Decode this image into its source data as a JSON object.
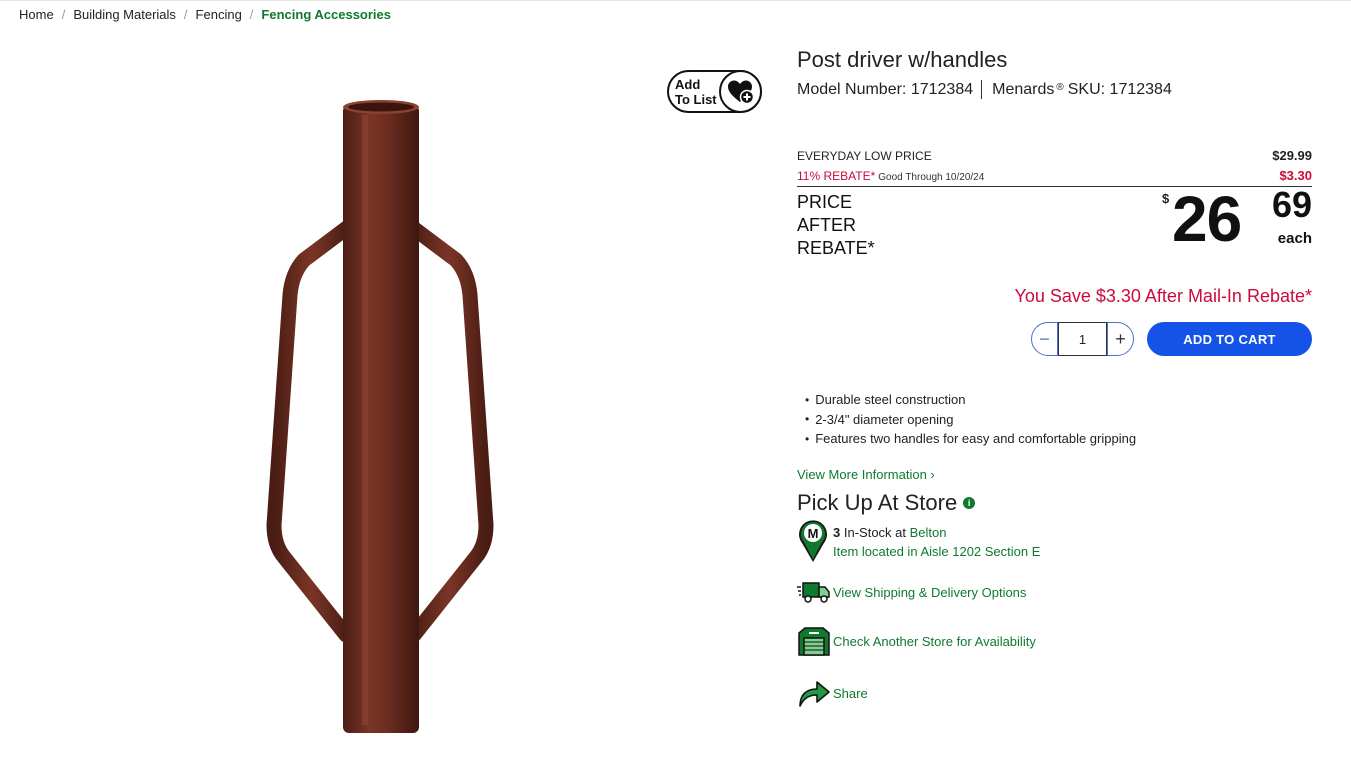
{
  "breadcrumb": {
    "items": [
      "Home",
      "Building Materials",
      "Fencing"
    ],
    "current": "Fencing Accessories",
    "separator": "/"
  },
  "add_to_list": {
    "line1": "Add",
    "line2": "To List",
    "icon": "heart-plus-icon"
  },
  "product": {
    "title": "Post driver w/handles",
    "model_label": "Model Number:",
    "model_number": "1712384",
    "sku_brand": "Menards",
    "sku_reg": "®",
    "sku_label": "SKU:",
    "sku": "1712384",
    "image_color": "#6b2c20"
  },
  "pricing": {
    "everyday_label": "EVERYDAY LOW PRICE",
    "everyday_amount": "$29.99",
    "rebate_label": "11% REBATE*",
    "rebate_good": "Good Through 10/20/24",
    "rebate_amount": "$3.30",
    "par_label_1": "PRICE",
    "par_label_2": "AFTER",
    "par_label_3": "REBATE*",
    "dollar_sign": "$",
    "whole": "26",
    "cents": "69",
    "unit": "each",
    "you_save": "You Save $3.30 After Mail-In Rebate*",
    "accent_red": "#cc0a3c"
  },
  "cart": {
    "minus": "−",
    "plus": "+",
    "quantity": "1",
    "add_label": "ADD TO CART",
    "button_color": "#1452e8"
  },
  "features": [
    "Durable steel construction",
    "2-3/4\" diameter opening",
    "Features two handles for easy and comfortable gripping"
  ],
  "view_more": "View More Information ›",
  "pickup": {
    "title": "Pick Up At Store",
    "info_icon": "info-icon",
    "count": "3",
    "in_stock_text": "In-Stock at",
    "store": "Belton",
    "aisle": "Item located in Aisle 1202 Section E",
    "brand_green": "#0f7a2e"
  },
  "options": {
    "shipping": "View Shipping & Delivery Options",
    "check_store": "Check Another Store for Availability",
    "share": "Share"
  }
}
